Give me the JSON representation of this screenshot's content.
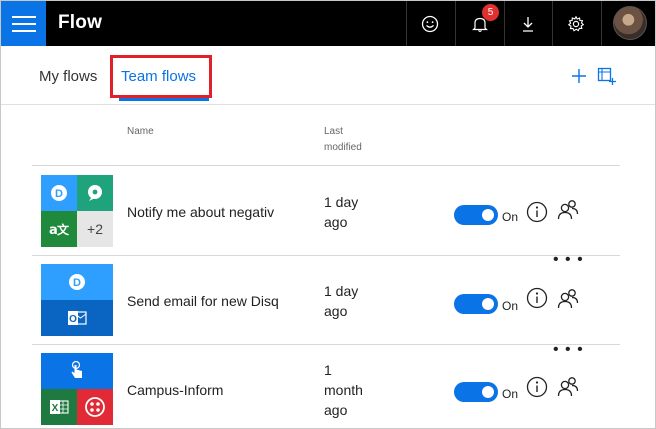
{
  "topbar": {
    "app_title": "Flow",
    "icons": [
      "menu-icon",
      "smiley-icon",
      "bell-icon",
      "download-icon",
      "gear-icon",
      "avatar"
    ],
    "notification_count": "5",
    "accent": "#0a73e6"
  },
  "tabs": {
    "my_flows": "My flows",
    "team_flows": "Team flows",
    "active": "team_flows",
    "actions": [
      "plus-icon",
      "import-icon"
    ]
  },
  "table": {
    "col_name": "Name",
    "col_modified_1": "Last",
    "col_modified_2": "modified",
    "rows": [
      {
        "name": "Notify me about negativ",
        "modified": [
          "1 day",
          "ago"
        ],
        "status": "On",
        "tiles": [
          "disqus",
          "chat-bubble",
          "translator",
          "+2"
        ],
        "more_count": "+2"
      },
      {
        "name": "Send email for new Disq",
        "modified": [
          "1 day",
          "ago"
        ],
        "status": "On",
        "tiles": [
          "disqus",
          "outlook"
        ]
      },
      {
        "name": "Campus-Inform",
        "modified": [
          "1",
          "month",
          "ago"
        ],
        "status": "On",
        "tiles": [
          "touch",
          "excel",
          "twilio"
        ]
      }
    ]
  }
}
